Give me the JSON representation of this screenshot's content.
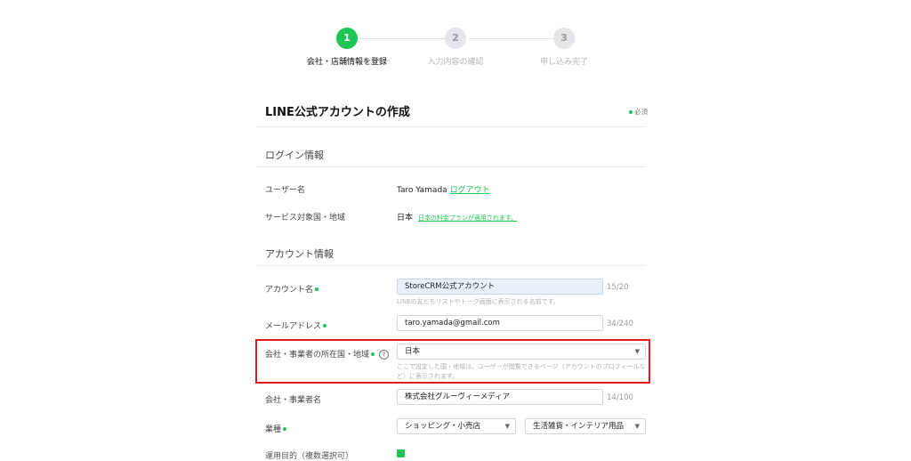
{
  "stepper": {
    "steps": [
      {
        "number": "1",
        "label": "会社・店舗情報を登録"
      },
      {
        "number": "2",
        "label": "入力内容の確認"
      },
      {
        "number": "3",
        "label": "申し込み完了"
      }
    ]
  },
  "page": {
    "title": "LINE公式アカウントの作成",
    "required_note": "必須"
  },
  "login_section": {
    "title": "ログイン情報",
    "username_label": "ユーザー名",
    "username_value": "Taro Yamada",
    "logout_link": "ログアウト",
    "service_region_label": "サービス対象国・地域",
    "service_region_value": "日本",
    "pricing_link": "日本の料金プランが適用されます。"
  },
  "account_section": {
    "title": "アカウント情報",
    "account_name_label": "アカウント名",
    "account_name_value": "StoreCRM公式アカウント",
    "account_name_counter": "15/20",
    "account_name_help": "LINEの友だちリストやトーク画面に表示される名前です。",
    "email_label": "メールアドレス",
    "email_value": "taro.yamada@gmail.com",
    "email_counter": "34/240",
    "country_label": "会社・事業者の所在国・地域",
    "country_value": "日本",
    "country_help": "ここで設定した国・地域は、ユーザーが閲覧できるページ（アカウントのプロフィールなど）に表示されます。",
    "company_label": "会社・事業者名",
    "company_value": "株式会社グルーヴィーメディア",
    "company_counter": "14/100",
    "industry_label": "業種",
    "industry_main_value": "ショッピング・小売店",
    "industry_sub_value": "生活雑貨・インテリア用品",
    "next_label_partial": "運用目的（複数選択可）"
  },
  "colors": {
    "accent": "#1dc456",
    "highlight": "#e11b22"
  }
}
